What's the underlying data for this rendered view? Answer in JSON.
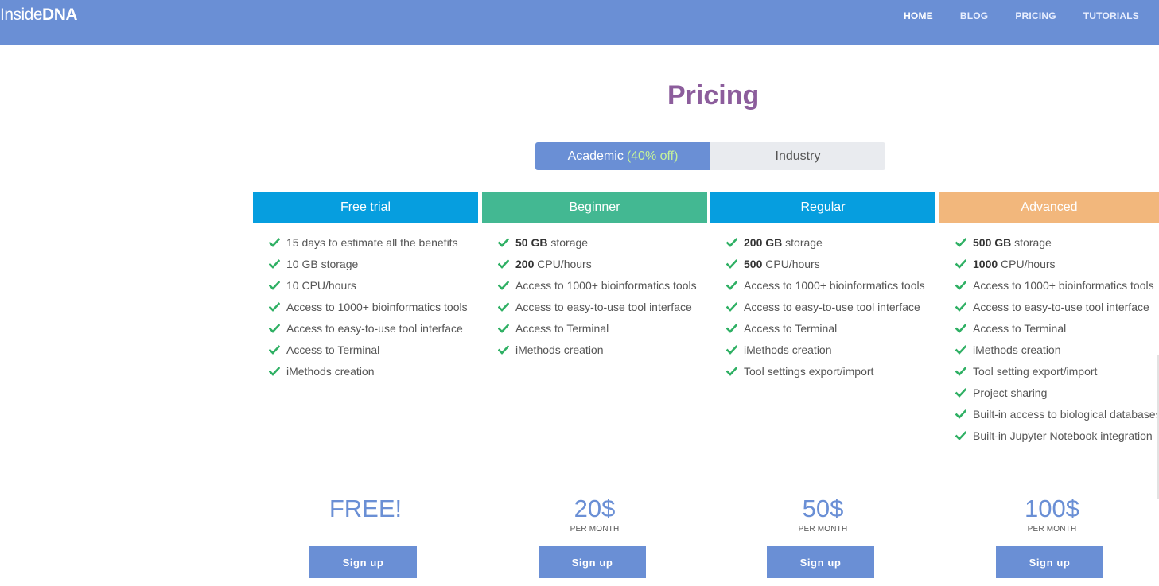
{
  "brand": {
    "light": "Inside",
    "bold": "DNA"
  },
  "nav": [
    {
      "label": "HOME"
    },
    {
      "label": "BLOG"
    },
    {
      "label": "PRICING"
    },
    {
      "label": "TUTORIALS"
    }
  ],
  "page_title": "Pricing",
  "toggle": {
    "academic_label": "Academic",
    "academic_discount": "(40% off)",
    "industry_label": "Industry"
  },
  "colors": {
    "nav": "#6a8fd5",
    "title": "#8c5d9c",
    "free_trial": "#069edf",
    "beginner": "#43b892",
    "regular": "#069edf",
    "advanced": "#f2b77c",
    "check": "#2fb064"
  },
  "plans": [
    {
      "name": "Free trial",
      "features": [
        {
          "bold": "",
          "text": "15 days to estimate all the benefits"
        },
        {
          "bold": "",
          "text": "10 GB storage"
        },
        {
          "bold": "",
          "text": "10 CPU/hours"
        },
        {
          "bold": "",
          "text": "Access to 1000+ bioinformatics tools"
        },
        {
          "bold": "",
          "text": "Access to easy-to-use tool interface"
        },
        {
          "bold": "",
          "text": "Access to Terminal"
        },
        {
          "bold": "",
          "text": "iMethods creation"
        }
      ],
      "price": "FREE!",
      "per_month": "",
      "signup": "Sign up"
    },
    {
      "name": "Beginner",
      "features": [
        {
          "bold": "50 GB",
          "text": " storage"
        },
        {
          "bold": "200",
          "text": " CPU/hours"
        },
        {
          "bold": "",
          "text": "Access to 1000+ bioinformatics tools"
        },
        {
          "bold": "",
          "text": "Access to easy-to-use tool interface"
        },
        {
          "bold": "",
          "text": "Access to Terminal"
        },
        {
          "bold": "",
          "text": "iMethods creation"
        }
      ],
      "price": "20$",
      "per_month": "PER MONTH",
      "signup": "Sign up"
    },
    {
      "name": "Regular",
      "features": [
        {
          "bold": "200 GB",
          "text": " storage"
        },
        {
          "bold": "500",
          "text": " CPU/hours"
        },
        {
          "bold": "",
          "text": "Access to 1000+ bioinformatics tools"
        },
        {
          "bold": "",
          "text": "Access to easy-to-use tool interface"
        },
        {
          "bold": "",
          "text": "Access to Terminal"
        },
        {
          "bold": "",
          "text": "iMethods creation"
        },
        {
          "bold": "",
          "text": "Tool settings export/import"
        }
      ],
      "price": "50$",
      "per_month": "PER MONTH",
      "signup": "Sign up"
    },
    {
      "name": "Advanced",
      "features": [
        {
          "bold": "500 GB",
          "text": " storage"
        },
        {
          "bold": "1000",
          "text": " CPU/hours"
        },
        {
          "bold": "",
          "text": "Access to 1000+ bioinformatics tools"
        },
        {
          "bold": "",
          "text": "Access to easy-to-use tool interface"
        },
        {
          "bold": "",
          "text": "Access to Terminal"
        },
        {
          "bold": "",
          "text": "iMethods creation"
        },
        {
          "bold": "",
          "text": "Tool setting export/import"
        },
        {
          "bold": "",
          "text": "Project sharing"
        },
        {
          "bold": "",
          "text": "Built-in access to biological databases"
        },
        {
          "bold": "",
          "text": "Built-in Jupyter Notebook integration"
        }
      ],
      "price": "100$",
      "per_month": "PER MONTH",
      "signup": "Sign up"
    }
  ]
}
